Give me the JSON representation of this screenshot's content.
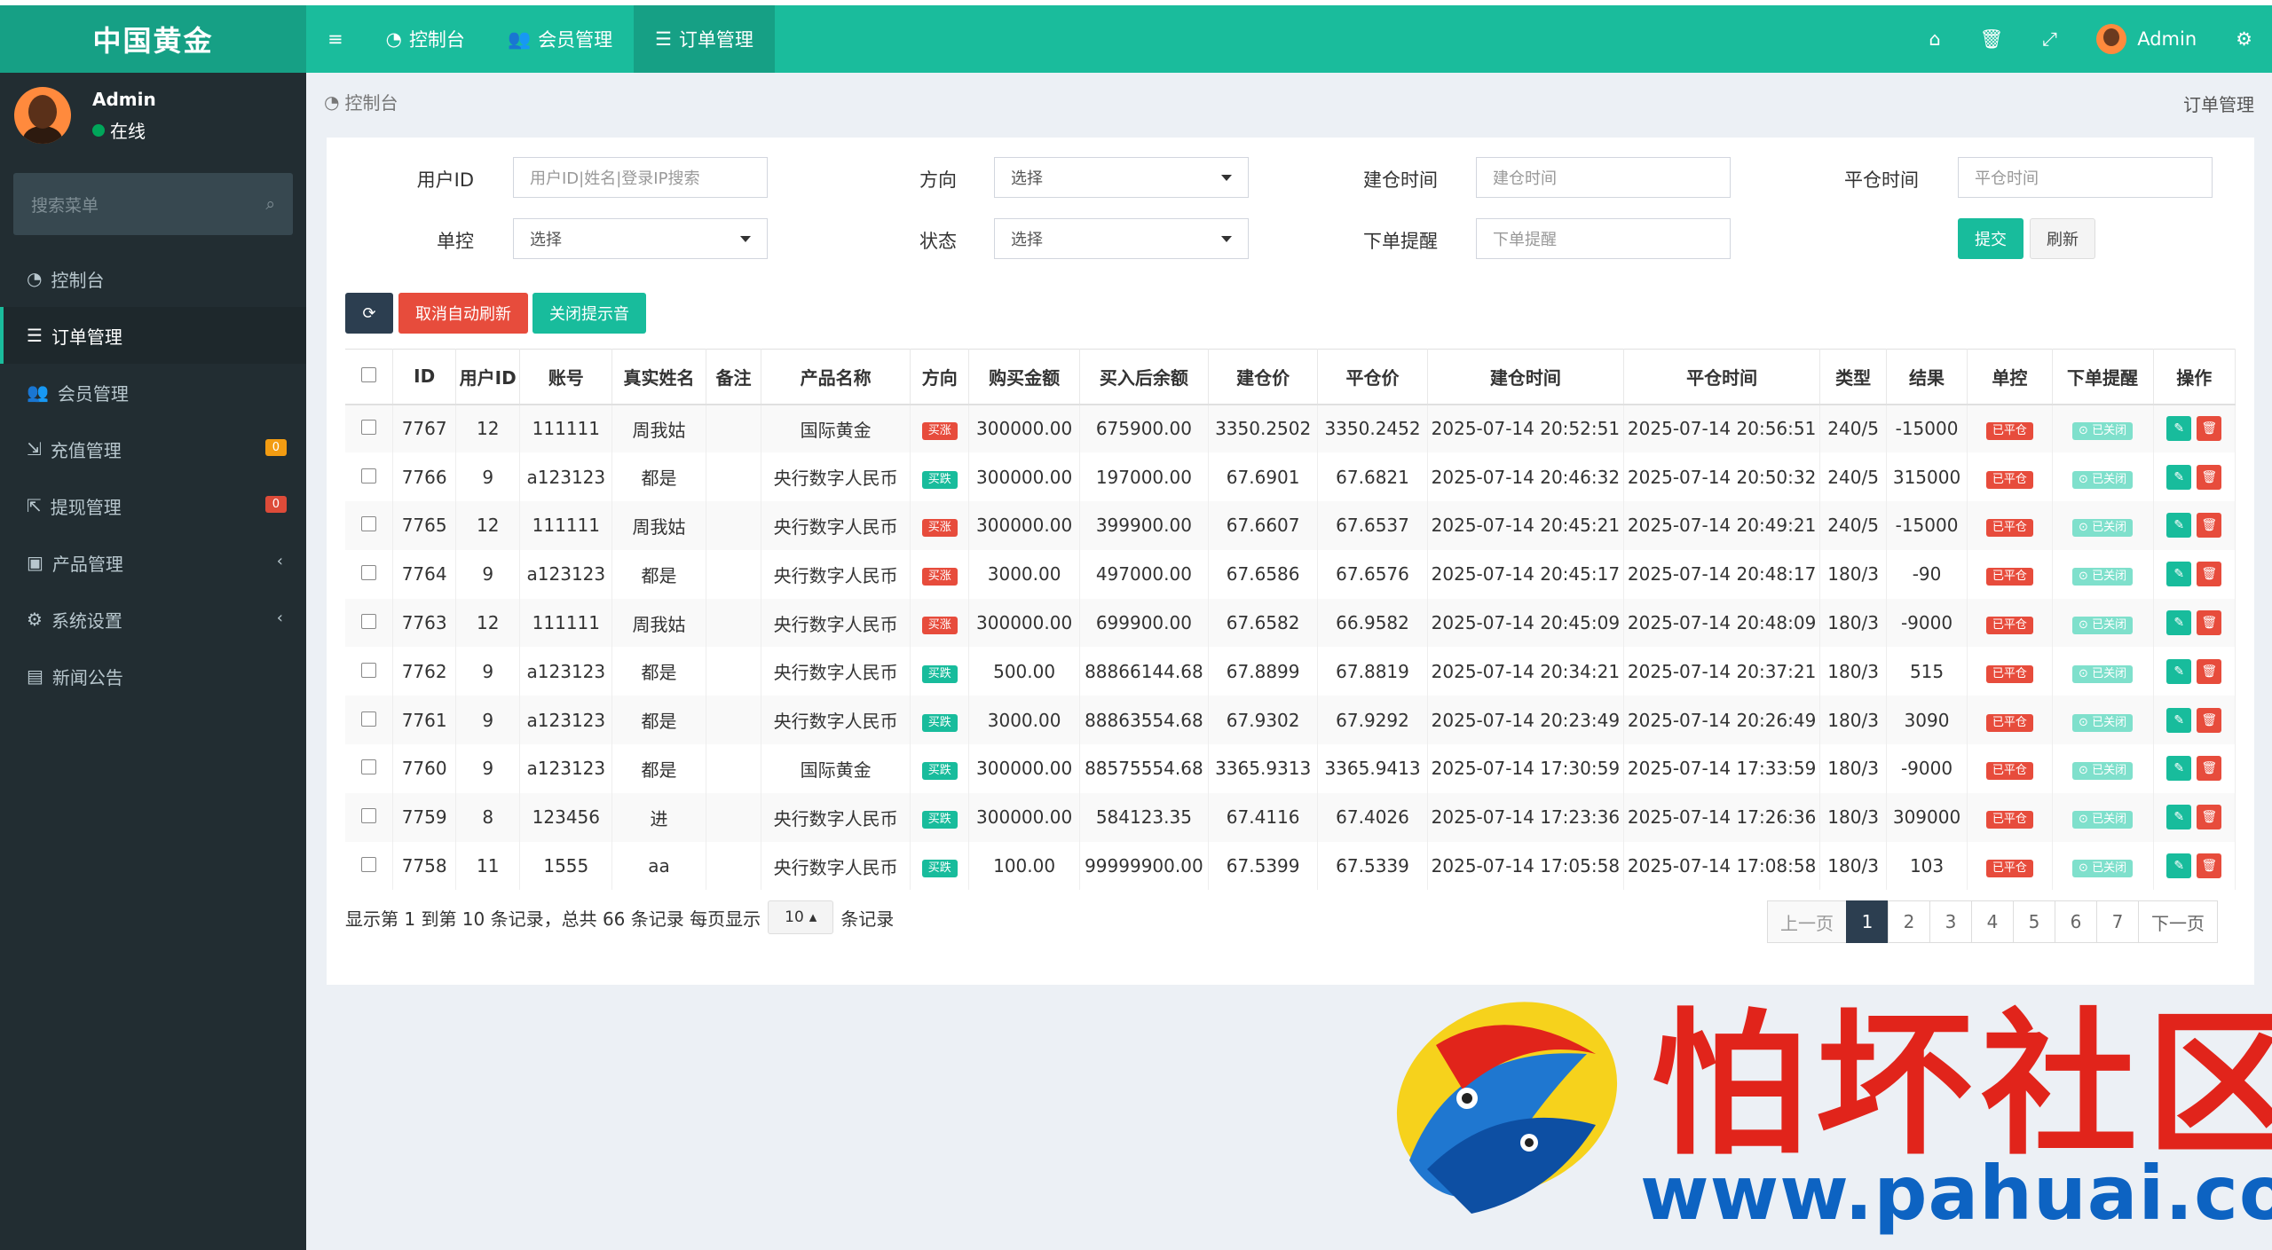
{
  "header": {
    "logo": "中国黄金",
    "nav": [
      {
        "label": "控制台"
      },
      {
        "label": "会员管理"
      },
      {
        "label": "订单管理"
      }
    ],
    "user": "Admin"
  },
  "sidebar": {
    "user_name": "Admin",
    "status": "在线",
    "search_placeholder": "搜索菜单",
    "items": [
      {
        "label": "控制台"
      },
      {
        "label": "订单管理"
      },
      {
        "label": "会员管理"
      },
      {
        "label": "充值管理",
        "badge": "0"
      },
      {
        "label": "提现管理",
        "badge": "0"
      },
      {
        "label": "产品管理"
      },
      {
        "label": "系统设置"
      },
      {
        "label": "新闻公告"
      }
    ]
  },
  "breadcrumb": {
    "left": "控制台",
    "right": "订单管理"
  },
  "filters": {
    "user_id_label": "用户ID",
    "user_id_placeholder": "用户ID|姓名|登录IP搜索",
    "direction_label": "方向",
    "direction_value": "选择",
    "open_time_label": "建仓时间",
    "open_time_placeholder": "建仓时间",
    "close_time_label": "平仓时间",
    "close_time_placeholder": "平仓时间",
    "single_control_label": "单控",
    "single_control_value": "选择",
    "state_label": "状态",
    "state_value": "选择",
    "order_alert_label": "下单提醒",
    "order_alert_placeholder": "下单提醒",
    "submit": "提交",
    "refresh": "刷新"
  },
  "toolbar": {
    "cancel_auto_refresh": "取消自动刷新",
    "close_sound": "关闭提示音"
  },
  "table": {
    "columns": [
      "ID",
      "用户ID",
      "账号",
      "真实姓名",
      "备注",
      "产品名称",
      "方向",
      "购买金额",
      "买入后余额",
      "建仓价",
      "平仓价",
      "建仓时间",
      "平仓时间",
      "类型",
      "结果",
      "单控",
      "下单提醒",
      "操作"
    ],
    "rows": [
      {
        "id": "7767",
        "uid": "12",
        "account": "111111",
        "name": "周我姑",
        "note": "",
        "product": "国际黄金",
        "dir": "买涨",
        "amount": "300000.00",
        "balance": "675900.00",
        "open": "3350.2502",
        "close": "3350.2452",
        "open_time": "2025-07-14 20:52:51",
        "close_time": "2025-07-14 20:56:51",
        "type": "240/5",
        "result": "-15000",
        "ctrl": "已平仓",
        "alert": "已关闭"
      },
      {
        "id": "7766",
        "uid": "9",
        "account": "a123123",
        "name": "都是",
        "note": "",
        "product": "央行数字人民币",
        "dir": "买跌",
        "amount": "300000.00",
        "balance": "197000.00",
        "open": "67.6901",
        "close": "67.6821",
        "open_time": "2025-07-14 20:46:32",
        "close_time": "2025-07-14 20:50:32",
        "type": "240/5",
        "result": "315000",
        "ctrl": "已平仓",
        "alert": "已关闭"
      },
      {
        "id": "7765",
        "uid": "12",
        "account": "111111",
        "name": "周我姑",
        "note": "",
        "product": "央行数字人民币",
        "dir": "买涨",
        "amount": "300000.00",
        "balance": "399900.00",
        "open": "67.6607",
        "close": "67.6537",
        "open_time": "2025-07-14 20:45:21",
        "close_time": "2025-07-14 20:49:21",
        "type": "240/5",
        "result": "-15000",
        "ctrl": "已平仓",
        "alert": "已关闭"
      },
      {
        "id": "7764",
        "uid": "9",
        "account": "a123123",
        "name": "都是",
        "note": "",
        "product": "央行数字人民币",
        "dir": "买涨",
        "amount": "3000.00",
        "balance": "497000.00",
        "open": "67.6586",
        "close": "67.6576",
        "open_time": "2025-07-14 20:45:17",
        "close_time": "2025-07-14 20:48:17",
        "type": "180/3",
        "result": "-90",
        "ctrl": "已平仓",
        "alert": "已关闭"
      },
      {
        "id": "7763",
        "uid": "12",
        "account": "111111",
        "name": "周我姑",
        "note": "",
        "product": "央行数字人民币",
        "dir": "买涨",
        "amount": "300000.00",
        "balance": "699900.00",
        "open": "67.6582",
        "close": "66.9582",
        "open_time": "2025-07-14 20:45:09",
        "close_time": "2025-07-14 20:48:09",
        "type": "180/3",
        "result": "-9000",
        "ctrl": "已平仓",
        "alert": "已关闭"
      },
      {
        "id": "7762",
        "uid": "9",
        "account": "a123123",
        "name": "都是",
        "note": "",
        "product": "央行数字人民币",
        "dir": "买跌",
        "amount": "500.00",
        "balance": "88866144.68",
        "open": "67.8899",
        "close": "67.8819",
        "open_time": "2025-07-14 20:34:21",
        "close_time": "2025-07-14 20:37:21",
        "type": "180/3",
        "result": "515",
        "ctrl": "已平仓",
        "alert": "已关闭"
      },
      {
        "id": "7761",
        "uid": "9",
        "account": "a123123",
        "name": "都是",
        "note": "",
        "product": "央行数字人民币",
        "dir": "买跌",
        "amount": "3000.00",
        "balance": "88863554.68",
        "open": "67.9302",
        "close": "67.9292",
        "open_time": "2025-07-14 20:23:49",
        "close_time": "2025-07-14 20:26:49",
        "type": "180/3",
        "result": "3090",
        "ctrl": "已平仓",
        "alert": "已关闭"
      },
      {
        "id": "7760",
        "uid": "9",
        "account": "a123123",
        "name": "都是",
        "note": "",
        "product": "国际黄金",
        "dir": "买跌",
        "amount": "300000.00",
        "balance": "88575554.68",
        "open": "3365.9313",
        "close": "3365.9413",
        "open_time": "2025-07-14 17:30:59",
        "close_time": "2025-07-14 17:33:59",
        "type": "180/3",
        "result": "-9000",
        "ctrl": "已平仓",
        "alert": "已关闭"
      },
      {
        "id": "7759",
        "uid": "8",
        "account": "123456",
        "name": "进",
        "note": "",
        "product": "央行数字人民币",
        "dir": "买跌",
        "amount": "300000.00",
        "balance": "584123.35",
        "open": "67.4116",
        "close": "67.4026",
        "open_time": "2025-07-14 17:23:36",
        "close_time": "2025-07-14 17:26:36",
        "type": "180/3",
        "result": "309000",
        "ctrl": "已平仓",
        "alert": "已关闭"
      },
      {
        "id": "7758",
        "uid": "11",
        "account": "1555",
        "name": "aa",
        "note": "",
        "product": "央行数字人民币",
        "dir": "买跌",
        "amount": "100.00",
        "balance": "99999900.00",
        "open": "67.5399",
        "close": "67.5339",
        "open_time": "2025-07-14 17:05:58",
        "close_time": "2025-07-14 17:08:58",
        "type": "180/3",
        "result": "103",
        "ctrl": "已平仓",
        "alert": "已关闭"
      }
    ]
  },
  "pagination": {
    "info": "显示第 1 到第 10 条记录，总共 66 条记录 每页显示",
    "page_size": "10",
    "suffix": "条记录",
    "prev": "上一页",
    "pages": [
      "1",
      "2",
      "3",
      "4",
      "5",
      "6",
      "7"
    ],
    "current": "1",
    "next": "下一页"
  },
  "watermark": {
    "text": "怕坏社区",
    "url": "www.pahuai.com"
  },
  "colors": {
    "accent": "#1abc9c",
    "accent_dark": "#16a085",
    "sidebar": "#222d32",
    "danger": "#e74c3c",
    "page_current": "#2c3e50"
  }
}
